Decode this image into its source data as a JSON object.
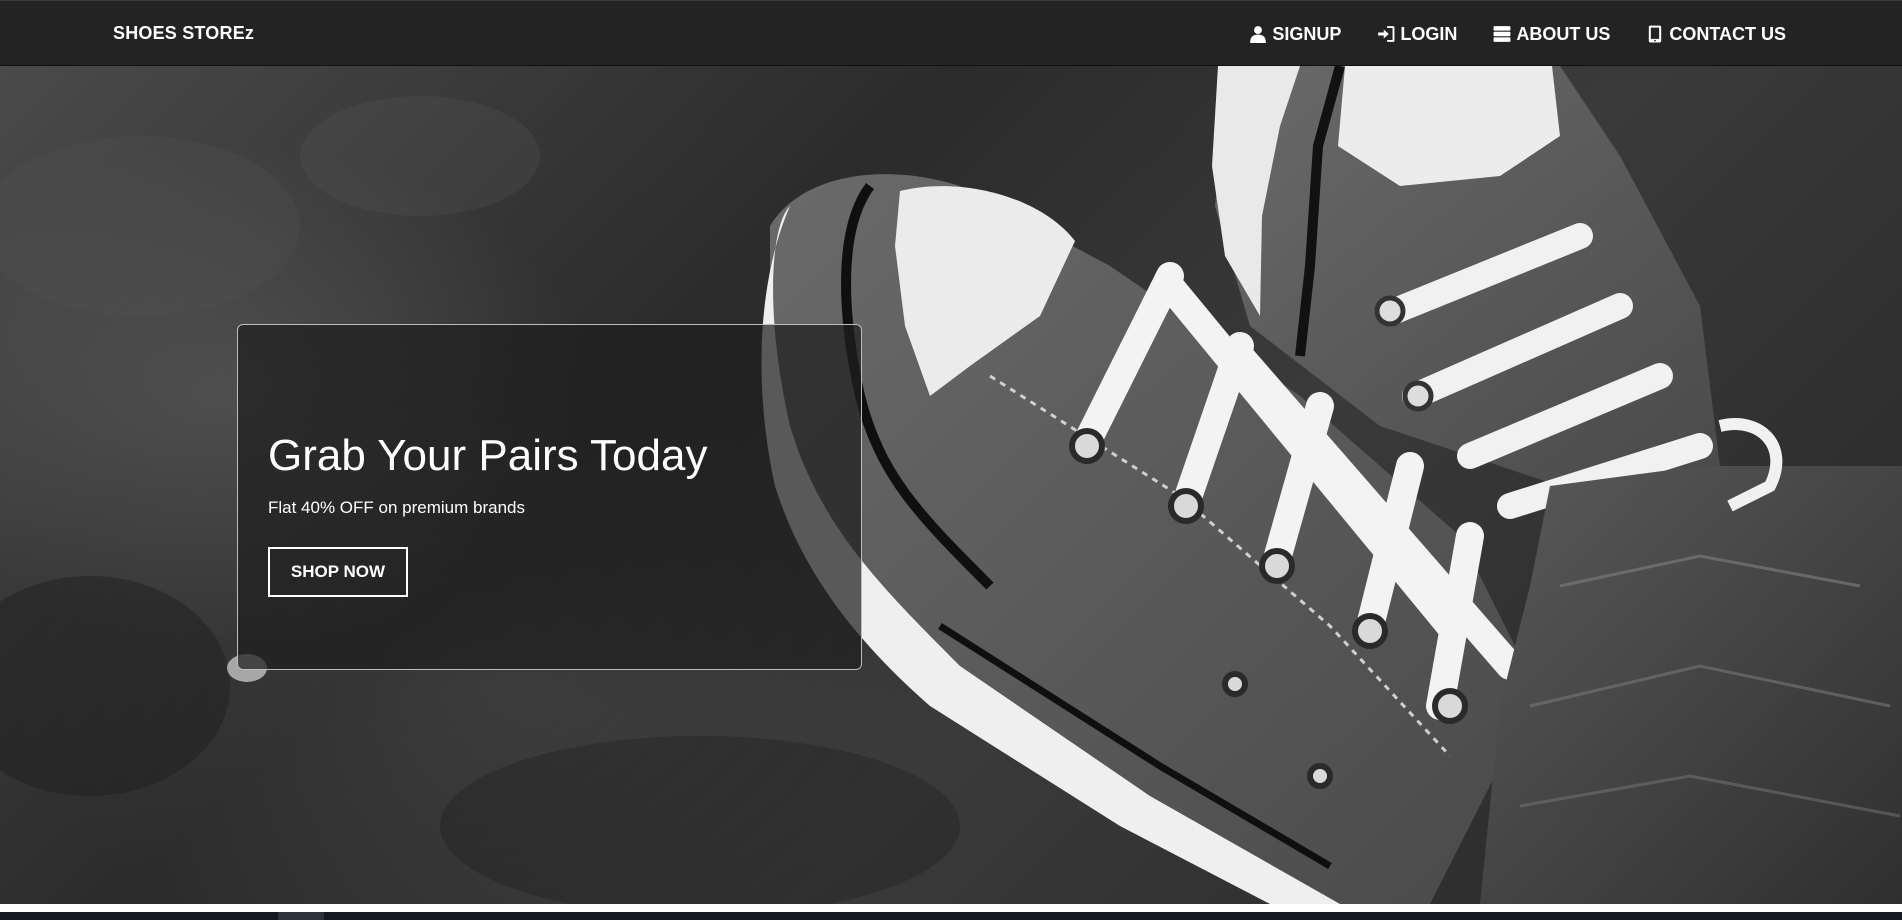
{
  "navbar": {
    "brand": "SHOES STOREz",
    "links": [
      {
        "label": "SIGNUP",
        "icon": "user-icon"
      },
      {
        "label": "LOGIN",
        "icon": "login-icon"
      },
      {
        "label": "ABOUT US",
        "icon": "server-icon"
      },
      {
        "label": "CONTACT US",
        "icon": "mobile-icon"
      }
    ]
  },
  "hero": {
    "title": "Grab Your Pairs Today",
    "subtitle": "Flat 40% OFF on premium brands",
    "cta_label": "SHOP NOW"
  }
}
